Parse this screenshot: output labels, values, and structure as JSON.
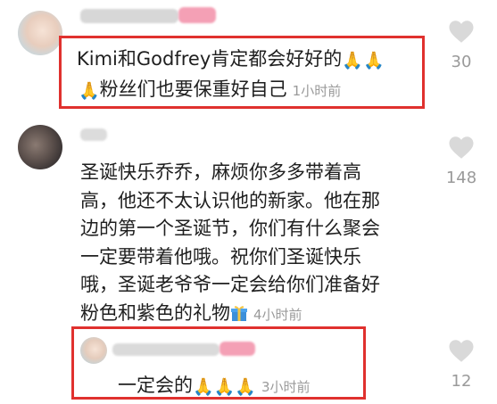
{
  "comments": [
    {
      "text_line1": "Kimi和Godfrey肯定都会好好的",
      "text_line2": "粉丝们也要保重好自己",
      "time": "1小时前",
      "likes": "30",
      "emoji_prayer": "🙏"
    },
    {
      "lines": [
        "圣诞快乐乔乔，麻烦你多多带着高",
        "高，他还不太认识他的新家。他在那",
        "边的第一个圣诞节，你们有什么聚会",
        "一定要带着他哦。祝你们圣诞快乐",
        "哦，圣诞老爷爷一定会给你们准备好"
      ],
      "last_line": "粉色和紫色的礼物",
      "time": "4小时前",
      "likes": "148"
    },
    {
      "text": "一定会的",
      "time": "3小时前",
      "likes": "12",
      "emoji_prayer": "🙏"
    }
  ],
  "colors": {
    "highlight_border": "#e0312e",
    "time_text": "#9a9a9a",
    "heart": "#d9d9d9",
    "pink_blur": "#f4a0b5"
  },
  "icons": {
    "like": "heart-icon",
    "gift": "gift-icon",
    "prayer": "prayer-hands-emoji"
  }
}
